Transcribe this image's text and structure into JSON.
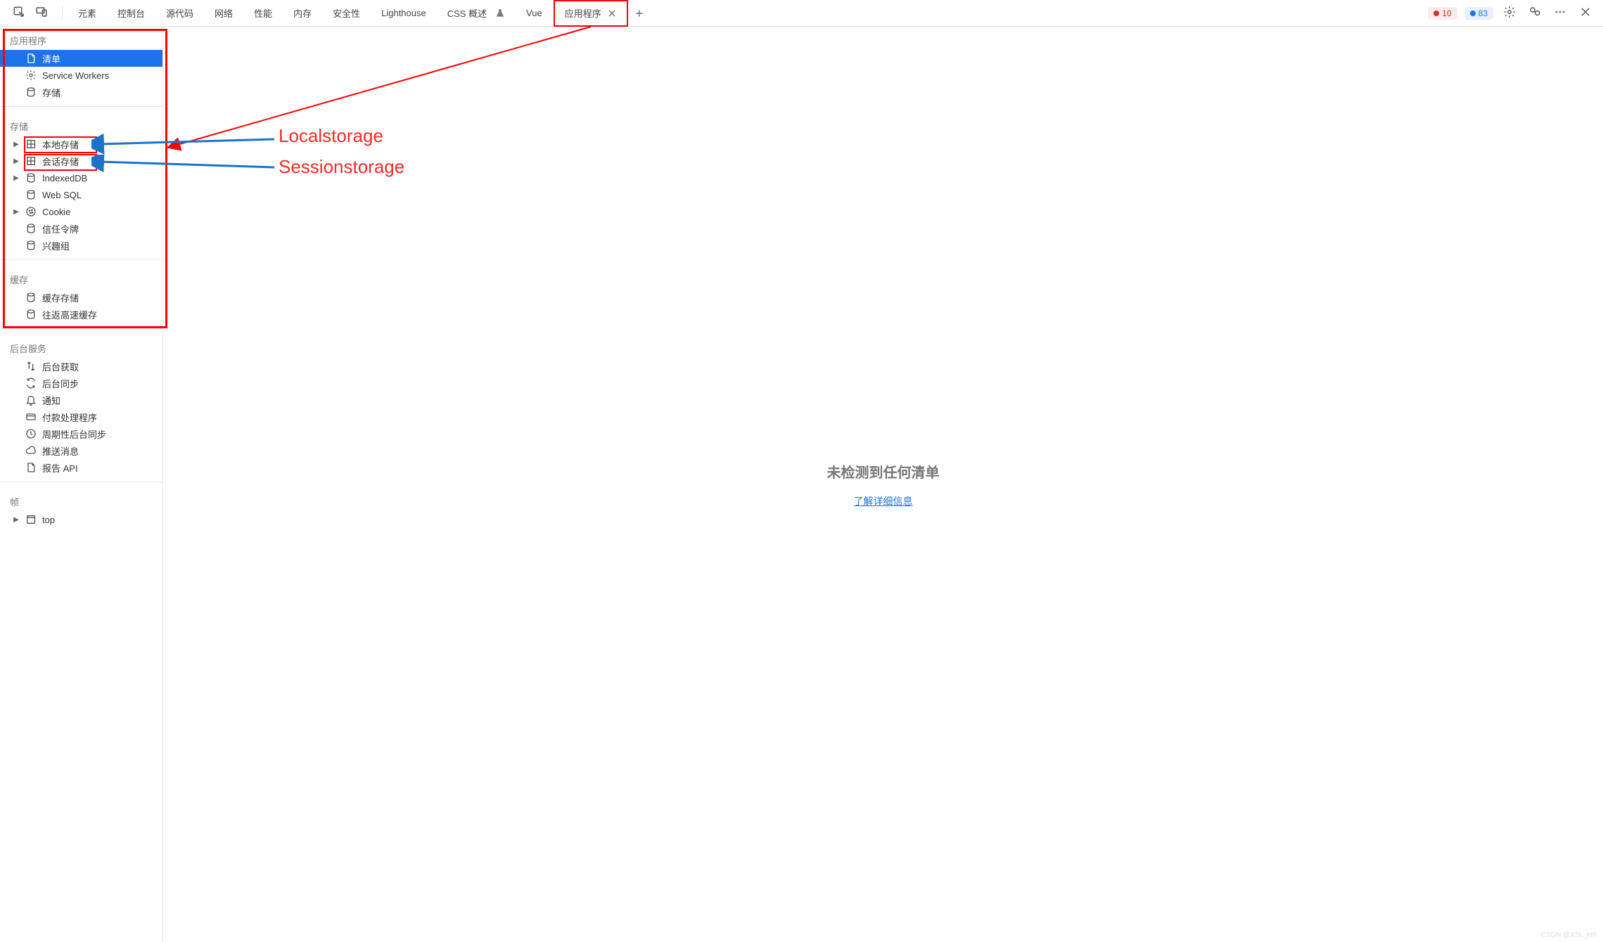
{
  "tabs": {
    "items": [
      "元素",
      "控制台",
      "源代码",
      "网络",
      "性能",
      "内存",
      "安全性",
      "Lighthouse",
      "CSS 概述",
      "Vue",
      "应用程序"
    ],
    "active_index": 10,
    "css_overview_has_warn": true
  },
  "badges": {
    "error_count": "10",
    "info_count": "83"
  },
  "sidebar": {
    "section_app": {
      "title": "应用程序",
      "items": [
        "清单",
        "Service Workers",
        "存储"
      ],
      "selected_index": 0
    },
    "section_storage": {
      "title": "存储",
      "items": [
        "本地存储",
        "会话存储",
        "IndexedDB",
        "Web SQL",
        "Cookie",
        "信任令牌",
        "兴趣组"
      ],
      "expandable": [
        true,
        true,
        true,
        false,
        true,
        false,
        false
      ]
    },
    "section_cache": {
      "title": "缓存",
      "items": [
        "缓存存储",
        "往返高速缓存"
      ]
    },
    "section_bg": {
      "title": "后台服务",
      "items": [
        "后台获取",
        "后台同步",
        "通知",
        "付款处理程序",
        "周期性后台同步",
        "推送消息",
        "报告 API"
      ]
    },
    "section_frame": {
      "title": "帧",
      "items": [
        "top"
      ]
    }
  },
  "main": {
    "empty_title": "未检测到任何清单",
    "learn_more": "了解详细信息"
  },
  "annotations": {
    "local": "Localstorage",
    "session": "Sessionstorage"
  },
  "watermark": "CSDN @XSL_HR"
}
